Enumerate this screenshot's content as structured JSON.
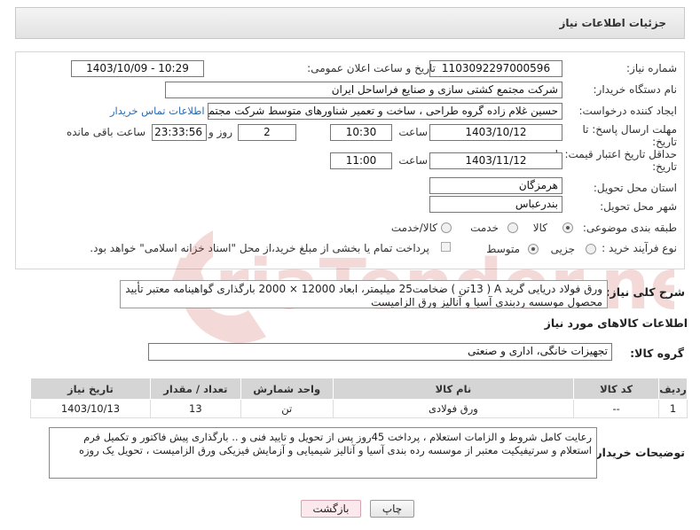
{
  "header": {
    "title": "جزئیات اطلاعات نیاز"
  },
  "form": {
    "need_number_label": "شماره نیاز:",
    "need_number": "1103092297000596",
    "announce_label": "تاریخ و ساعت اعلان عمومی:",
    "announce_value": "1403/10/09 - 10:29",
    "buyer_label": "نام دستگاه خریدار:",
    "buyer_value": "شرکت مجتمع کشتی سازی و صنایع فراساحل ایران",
    "creator_label": "ایجاد کننده درخواست:",
    "creator_value": "حسین  غلام زاده گروه طراحی ، ساخت و تعمیر شناورهای متوسط شرکت مجتمع",
    "contact_link": "اطلاعات تماس خریدار",
    "deadline_label": "مهلت ارسال پاسخ: تا",
    "deadline_label2": "تاریخ:",
    "deadline_date": "1403/10/12",
    "time_label": "ساعت",
    "deadline_time": "10:30",
    "days_value": "2",
    "days_label": "روز و",
    "remaining_value": "23:33:56",
    "remaining_label": "ساعت باقی مانده",
    "validity_label": "حداقل تاریخ اعتبار قیمت: تا",
    "validity_label2": "تاریخ:",
    "validity_date": "1403/11/12",
    "validity_time": "11:00",
    "province_label": "استان محل تحویل:",
    "province_value": "هرمزگان",
    "city_label": "شهر محل تحویل:",
    "city_value": "بندرعباس",
    "category_label": "طبقه بندی موضوعی:",
    "category_goods": "کالا",
    "category_service": "خدمت",
    "category_both": "کالا/خدمت",
    "process_label": "نوع فرآیند خرید :",
    "process_partial": "جزیی",
    "process_medium": "متوسط",
    "payment_note": "پرداخت تمام یا بخشی از مبلغ خرید،از محل \"اسناد خزانه اسلامی\" خواهد بود."
  },
  "description": {
    "label": "شرح کلی نیاز:",
    "text": "ورق فولاد دریایی  گرید A ( 13تن ) ضخامت25 میلیمتر، ابعاد 12000 × 2000 بارگذاری گواهینامه معتبر تأیید محصول موسسه ردبندی آسیا و آنالیز ورق الزامیست"
  },
  "goods": {
    "section_title": "اطلاعات کالاهای مورد نیاز",
    "group_label": "گروه کالا:",
    "group_value": "تجهیزات خانگی، اداری و صنعتی",
    "columns": [
      "ردیف",
      "کد کالا",
      "نام کالا",
      "واحد شمارش",
      "تعداد / مقدار",
      "تاریخ نیاز"
    ],
    "rows": [
      {
        "row": "1",
        "code": "--",
        "name": "ورق فولادی",
        "unit": "تن",
        "qty": "13",
        "date": "1403/10/13"
      }
    ]
  },
  "notes": {
    "label": "توضیحات خریدار:",
    "text": "رعایت کامل شروط و الزامات استعلام  ، پرداخت 45روز  پس از تحویل و تایید فنی و ..  بارگذاری پیش فاکتور و تکمیل فرم استعلام و سرتیفیکیت معتبر از موسسه رده بندی آسیا و آنالیز شیمیایی و آزمایش فیزیکی ورق الزامیست ، تحویل یک روزه"
  },
  "buttons": {
    "print": "چاپ",
    "back": "بازگشت"
  },
  "colors": {
    "link": "#2a6bb3",
    "header_bg": "#e8e8e8",
    "table_header": "#d5d5d5"
  }
}
